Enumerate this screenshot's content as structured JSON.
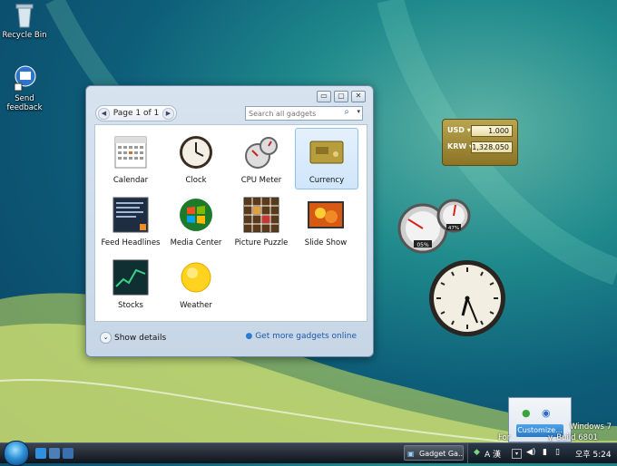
{
  "desktop": {
    "icons": [
      {
        "label": "Recycle Bin"
      },
      {
        "label": "Send\nfeedback"
      }
    ]
  },
  "gallery": {
    "page_label": "Page 1 of 1",
    "search_placeholder": "Search all gadgets",
    "gadgets": [
      {
        "label": "Calendar"
      },
      {
        "label": "Clock"
      },
      {
        "label": "CPU Meter"
      },
      {
        "label": "Currency"
      },
      {
        "label": "Feed Headlines"
      },
      {
        "label": "Media Center"
      },
      {
        "label": "Picture Puzzle"
      },
      {
        "label": "Slide Show"
      },
      {
        "label": "Stocks"
      },
      {
        "label": "Weather"
      }
    ],
    "show_details": "Show details",
    "get_more": "Get more gadgets online"
  },
  "currency_gadget": {
    "rows": [
      {
        "code": "USD",
        "value": "1.000"
      },
      {
        "code": "KRW",
        "value": "1,328.050"
      }
    ]
  },
  "cpu_meter": {
    "cpu": "05%",
    "mem": "47%"
  },
  "notification": {
    "customize_label": "Customize..."
  },
  "watermark": {
    "line1": "Windows 7",
    "line2_prefix": "For",
    "line2_suffix": "y. Build 6801"
  },
  "taskbar": {
    "task_label": "Gadget Ga...",
    "clock": "오후 5:24",
    "ime": "A 漢"
  },
  "colors": {
    "desktop": "#1f8a8c",
    "link": "#1b56a8",
    "selected_tile": "#cfe6fb"
  }
}
